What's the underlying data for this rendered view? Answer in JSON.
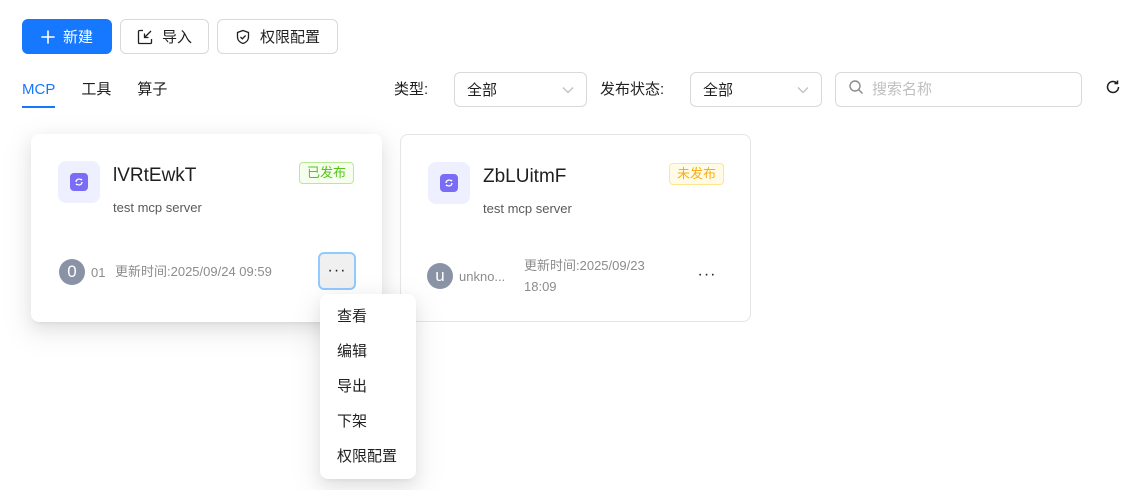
{
  "toolbar": {
    "new_label": "新建",
    "import_label": "导入",
    "permission_label": "权限配置"
  },
  "tabs": [
    {
      "label": "MCP",
      "active": true
    },
    {
      "label": "工具",
      "active": false
    },
    {
      "label": "算子",
      "active": false
    }
  ],
  "filters": {
    "type_label": "类型:",
    "type_value": "全部",
    "status_label": "发布状态:",
    "status_value": "全部",
    "search_placeholder": "搜索名称"
  },
  "cards": [
    {
      "title": "lVRtEwkT",
      "description": "test mcp server",
      "status": "已发布",
      "avatar_letter": "0",
      "owner": "01",
      "updated": "更新时间:2025/09/24 09:59"
    },
    {
      "title": "ZbLUitmF",
      "description": "test mcp server",
      "status": "未发布",
      "avatar_letter": "u",
      "owner": "unkno...",
      "updated_line1": "更新时间:2025/09/23",
      "updated_line2": "18:09"
    }
  ],
  "more_label": "···",
  "menu": {
    "items": [
      "查看",
      "编辑",
      "导出",
      "下架",
      "权限配置"
    ]
  },
  "colors": {
    "primary": "#1677ff",
    "published": "#52c41a",
    "unpublished": "#faad14"
  },
  "icons": [
    "plus-icon",
    "import-icon",
    "shield-icon",
    "chevron-down-icon",
    "search-icon",
    "refresh-icon",
    "mcp-server-icon"
  ]
}
